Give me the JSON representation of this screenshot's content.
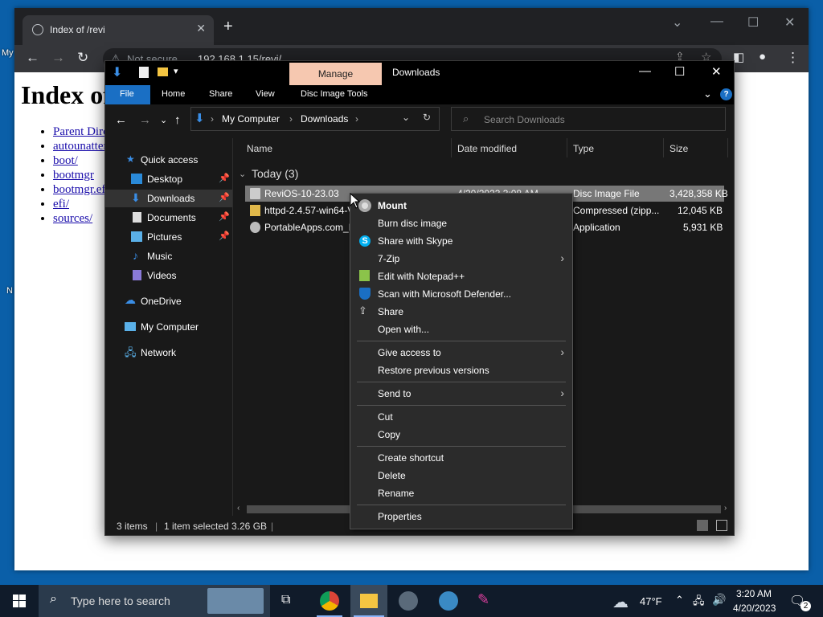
{
  "desktop": {
    "icon_label_1": "My",
    "icon_label_2": "N"
  },
  "browser": {
    "tab_title": "Index of /revi",
    "new_tab": "+",
    "security": "Not secure",
    "url": "192.168.1.15/revi/",
    "page_heading": "Index of /revi/",
    "links": [
      "Parent Directory",
      "autounattend.xml",
      "boot/",
      "bootmgr",
      "bootmgr.efi",
      "efi/",
      "sources/"
    ]
  },
  "explorer": {
    "contextual_tab": "Manage",
    "window_title": "Downloads",
    "ribbon_tabs": [
      "File",
      "Home",
      "Share",
      "View",
      "Disc Image Tools"
    ],
    "breadcrumb": [
      "My Computer",
      "Downloads"
    ],
    "search_placeholder": "Search Downloads",
    "nav_items": [
      {
        "label": "Quick access",
        "icon": "star-icon",
        "pinned": false
      },
      {
        "label": "Desktop",
        "icon": "desktop-folder-icon",
        "pinned": true
      },
      {
        "label": "Downloads",
        "icon": "download-folder-icon",
        "pinned": true,
        "selected": true
      },
      {
        "label": "Documents",
        "icon": "documents-folder-icon",
        "pinned": true
      },
      {
        "label": "Pictures",
        "icon": "pictures-folder-icon",
        "pinned": true
      },
      {
        "label": "Music",
        "icon": "music-folder-icon",
        "pinned": false
      },
      {
        "label": "Videos",
        "icon": "videos-folder-icon",
        "pinned": false
      },
      {
        "label": "OneDrive",
        "icon": "onedrive-icon",
        "pinned": false
      },
      {
        "label": "My Computer",
        "icon": "computer-icon",
        "pinned": false
      },
      {
        "label": "Network",
        "icon": "network-icon",
        "pinned": false
      }
    ],
    "columns": [
      "Name",
      "Date modified",
      "Type",
      "Size"
    ],
    "group": "Today (3)",
    "files": [
      {
        "name": "ReviOS-10-23.03",
        "date": "4/20/2023 3:08 AM",
        "type": "Disc Image File",
        "size": "3,428,358 KB",
        "selected": true
      },
      {
        "name": "httpd-2.4.57-win64-VS17",
        "date": "",
        "type": "Compressed (zipp...",
        "size": "12,045 KB"
      },
      {
        "name": "PortableApps.com_Platform_Setup",
        "date": "",
        "type": "Application",
        "size": "5,931 KB"
      }
    ],
    "status": {
      "items": "3 items",
      "selected": "1 item selected",
      "size": "3.26 GB"
    }
  },
  "context_menu": {
    "items": [
      {
        "label": "Mount",
        "bold": true,
        "icon": "disc-icon"
      },
      {
        "label": "Burn disc image"
      },
      {
        "label": "Share with Skype",
        "icon": "skype-icon"
      },
      {
        "label": "7-Zip",
        "submenu": true
      },
      {
        "label": "Edit with Notepad++",
        "icon": "notepadpp-icon"
      },
      {
        "label": "Scan with Microsoft Defender...",
        "icon": "defender-icon"
      },
      {
        "label": "Share",
        "icon": "share-icon"
      },
      {
        "label": "Open with..."
      },
      {
        "label": "Give access to",
        "submenu": true
      },
      {
        "label": "Restore previous versions"
      },
      {
        "label": "Send to",
        "submenu": true
      },
      {
        "label": "Cut"
      },
      {
        "label": "Copy"
      },
      {
        "label": "Create shortcut"
      },
      {
        "label": "Delete"
      },
      {
        "label": "Rename"
      },
      {
        "label": "Properties"
      }
    ]
  },
  "taskbar": {
    "search_placeholder": "Type here to search",
    "weather": "47°F",
    "time": "3:20 AM",
    "date": "4/20/2023",
    "notification_count": "2"
  }
}
